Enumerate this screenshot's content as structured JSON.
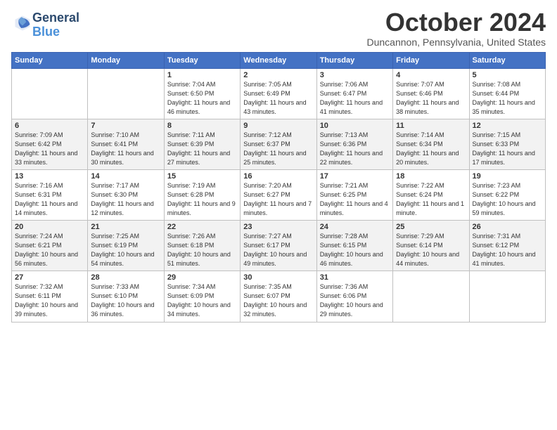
{
  "header": {
    "logo_line1": "General",
    "logo_line2": "Blue",
    "month": "October 2024",
    "location": "Duncannon, Pennsylvania, United States"
  },
  "days_of_week": [
    "Sunday",
    "Monday",
    "Tuesday",
    "Wednesday",
    "Thursday",
    "Friday",
    "Saturday"
  ],
  "weeks": [
    [
      {
        "day": "",
        "info": ""
      },
      {
        "day": "",
        "info": ""
      },
      {
        "day": "1",
        "info": "Sunrise: 7:04 AM\nSunset: 6:50 PM\nDaylight: 11 hours and 46 minutes."
      },
      {
        "day": "2",
        "info": "Sunrise: 7:05 AM\nSunset: 6:49 PM\nDaylight: 11 hours and 43 minutes."
      },
      {
        "day": "3",
        "info": "Sunrise: 7:06 AM\nSunset: 6:47 PM\nDaylight: 11 hours and 41 minutes."
      },
      {
        "day": "4",
        "info": "Sunrise: 7:07 AM\nSunset: 6:46 PM\nDaylight: 11 hours and 38 minutes."
      },
      {
        "day": "5",
        "info": "Sunrise: 7:08 AM\nSunset: 6:44 PM\nDaylight: 11 hours and 35 minutes."
      }
    ],
    [
      {
        "day": "6",
        "info": "Sunrise: 7:09 AM\nSunset: 6:42 PM\nDaylight: 11 hours and 33 minutes."
      },
      {
        "day": "7",
        "info": "Sunrise: 7:10 AM\nSunset: 6:41 PM\nDaylight: 11 hours and 30 minutes."
      },
      {
        "day": "8",
        "info": "Sunrise: 7:11 AM\nSunset: 6:39 PM\nDaylight: 11 hours and 27 minutes."
      },
      {
        "day": "9",
        "info": "Sunrise: 7:12 AM\nSunset: 6:37 PM\nDaylight: 11 hours and 25 minutes."
      },
      {
        "day": "10",
        "info": "Sunrise: 7:13 AM\nSunset: 6:36 PM\nDaylight: 11 hours and 22 minutes."
      },
      {
        "day": "11",
        "info": "Sunrise: 7:14 AM\nSunset: 6:34 PM\nDaylight: 11 hours and 20 minutes."
      },
      {
        "day": "12",
        "info": "Sunrise: 7:15 AM\nSunset: 6:33 PM\nDaylight: 11 hours and 17 minutes."
      }
    ],
    [
      {
        "day": "13",
        "info": "Sunrise: 7:16 AM\nSunset: 6:31 PM\nDaylight: 11 hours and 14 minutes."
      },
      {
        "day": "14",
        "info": "Sunrise: 7:17 AM\nSunset: 6:30 PM\nDaylight: 11 hours and 12 minutes."
      },
      {
        "day": "15",
        "info": "Sunrise: 7:19 AM\nSunset: 6:28 PM\nDaylight: 11 hours and 9 minutes."
      },
      {
        "day": "16",
        "info": "Sunrise: 7:20 AM\nSunset: 6:27 PM\nDaylight: 11 hours and 7 minutes."
      },
      {
        "day": "17",
        "info": "Sunrise: 7:21 AM\nSunset: 6:25 PM\nDaylight: 11 hours and 4 minutes."
      },
      {
        "day": "18",
        "info": "Sunrise: 7:22 AM\nSunset: 6:24 PM\nDaylight: 11 hours and 1 minute."
      },
      {
        "day": "19",
        "info": "Sunrise: 7:23 AM\nSunset: 6:22 PM\nDaylight: 10 hours and 59 minutes."
      }
    ],
    [
      {
        "day": "20",
        "info": "Sunrise: 7:24 AM\nSunset: 6:21 PM\nDaylight: 10 hours and 56 minutes."
      },
      {
        "day": "21",
        "info": "Sunrise: 7:25 AM\nSunset: 6:19 PM\nDaylight: 10 hours and 54 minutes."
      },
      {
        "day": "22",
        "info": "Sunrise: 7:26 AM\nSunset: 6:18 PM\nDaylight: 10 hours and 51 minutes."
      },
      {
        "day": "23",
        "info": "Sunrise: 7:27 AM\nSunset: 6:17 PM\nDaylight: 10 hours and 49 minutes."
      },
      {
        "day": "24",
        "info": "Sunrise: 7:28 AM\nSunset: 6:15 PM\nDaylight: 10 hours and 46 minutes."
      },
      {
        "day": "25",
        "info": "Sunrise: 7:29 AM\nSunset: 6:14 PM\nDaylight: 10 hours and 44 minutes."
      },
      {
        "day": "26",
        "info": "Sunrise: 7:31 AM\nSunset: 6:12 PM\nDaylight: 10 hours and 41 minutes."
      }
    ],
    [
      {
        "day": "27",
        "info": "Sunrise: 7:32 AM\nSunset: 6:11 PM\nDaylight: 10 hours and 39 minutes."
      },
      {
        "day": "28",
        "info": "Sunrise: 7:33 AM\nSunset: 6:10 PM\nDaylight: 10 hours and 36 minutes."
      },
      {
        "day": "29",
        "info": "Sunrise: 7:34 AM\nSunset: 6:09 PM\nDaylight: 10 hours and 34 minutes."
      },
      {
        "day": "30",
        "info": "Sunrise: 7:35 AM\nSunset: 6:07 PM\nDaylight: 10 hours and 32 minutes."
      },
      {
        "day": "31",
        "info": "Sunrise: 7:36 AM\nSunset: 6:06 PM\nDaylight: 10 hours and 29 minutes."
      },
      {
        "day": "",
        "info": ""
      },
      {
        "day": "",
        "info": ""
      }
    ]
  ]
}
